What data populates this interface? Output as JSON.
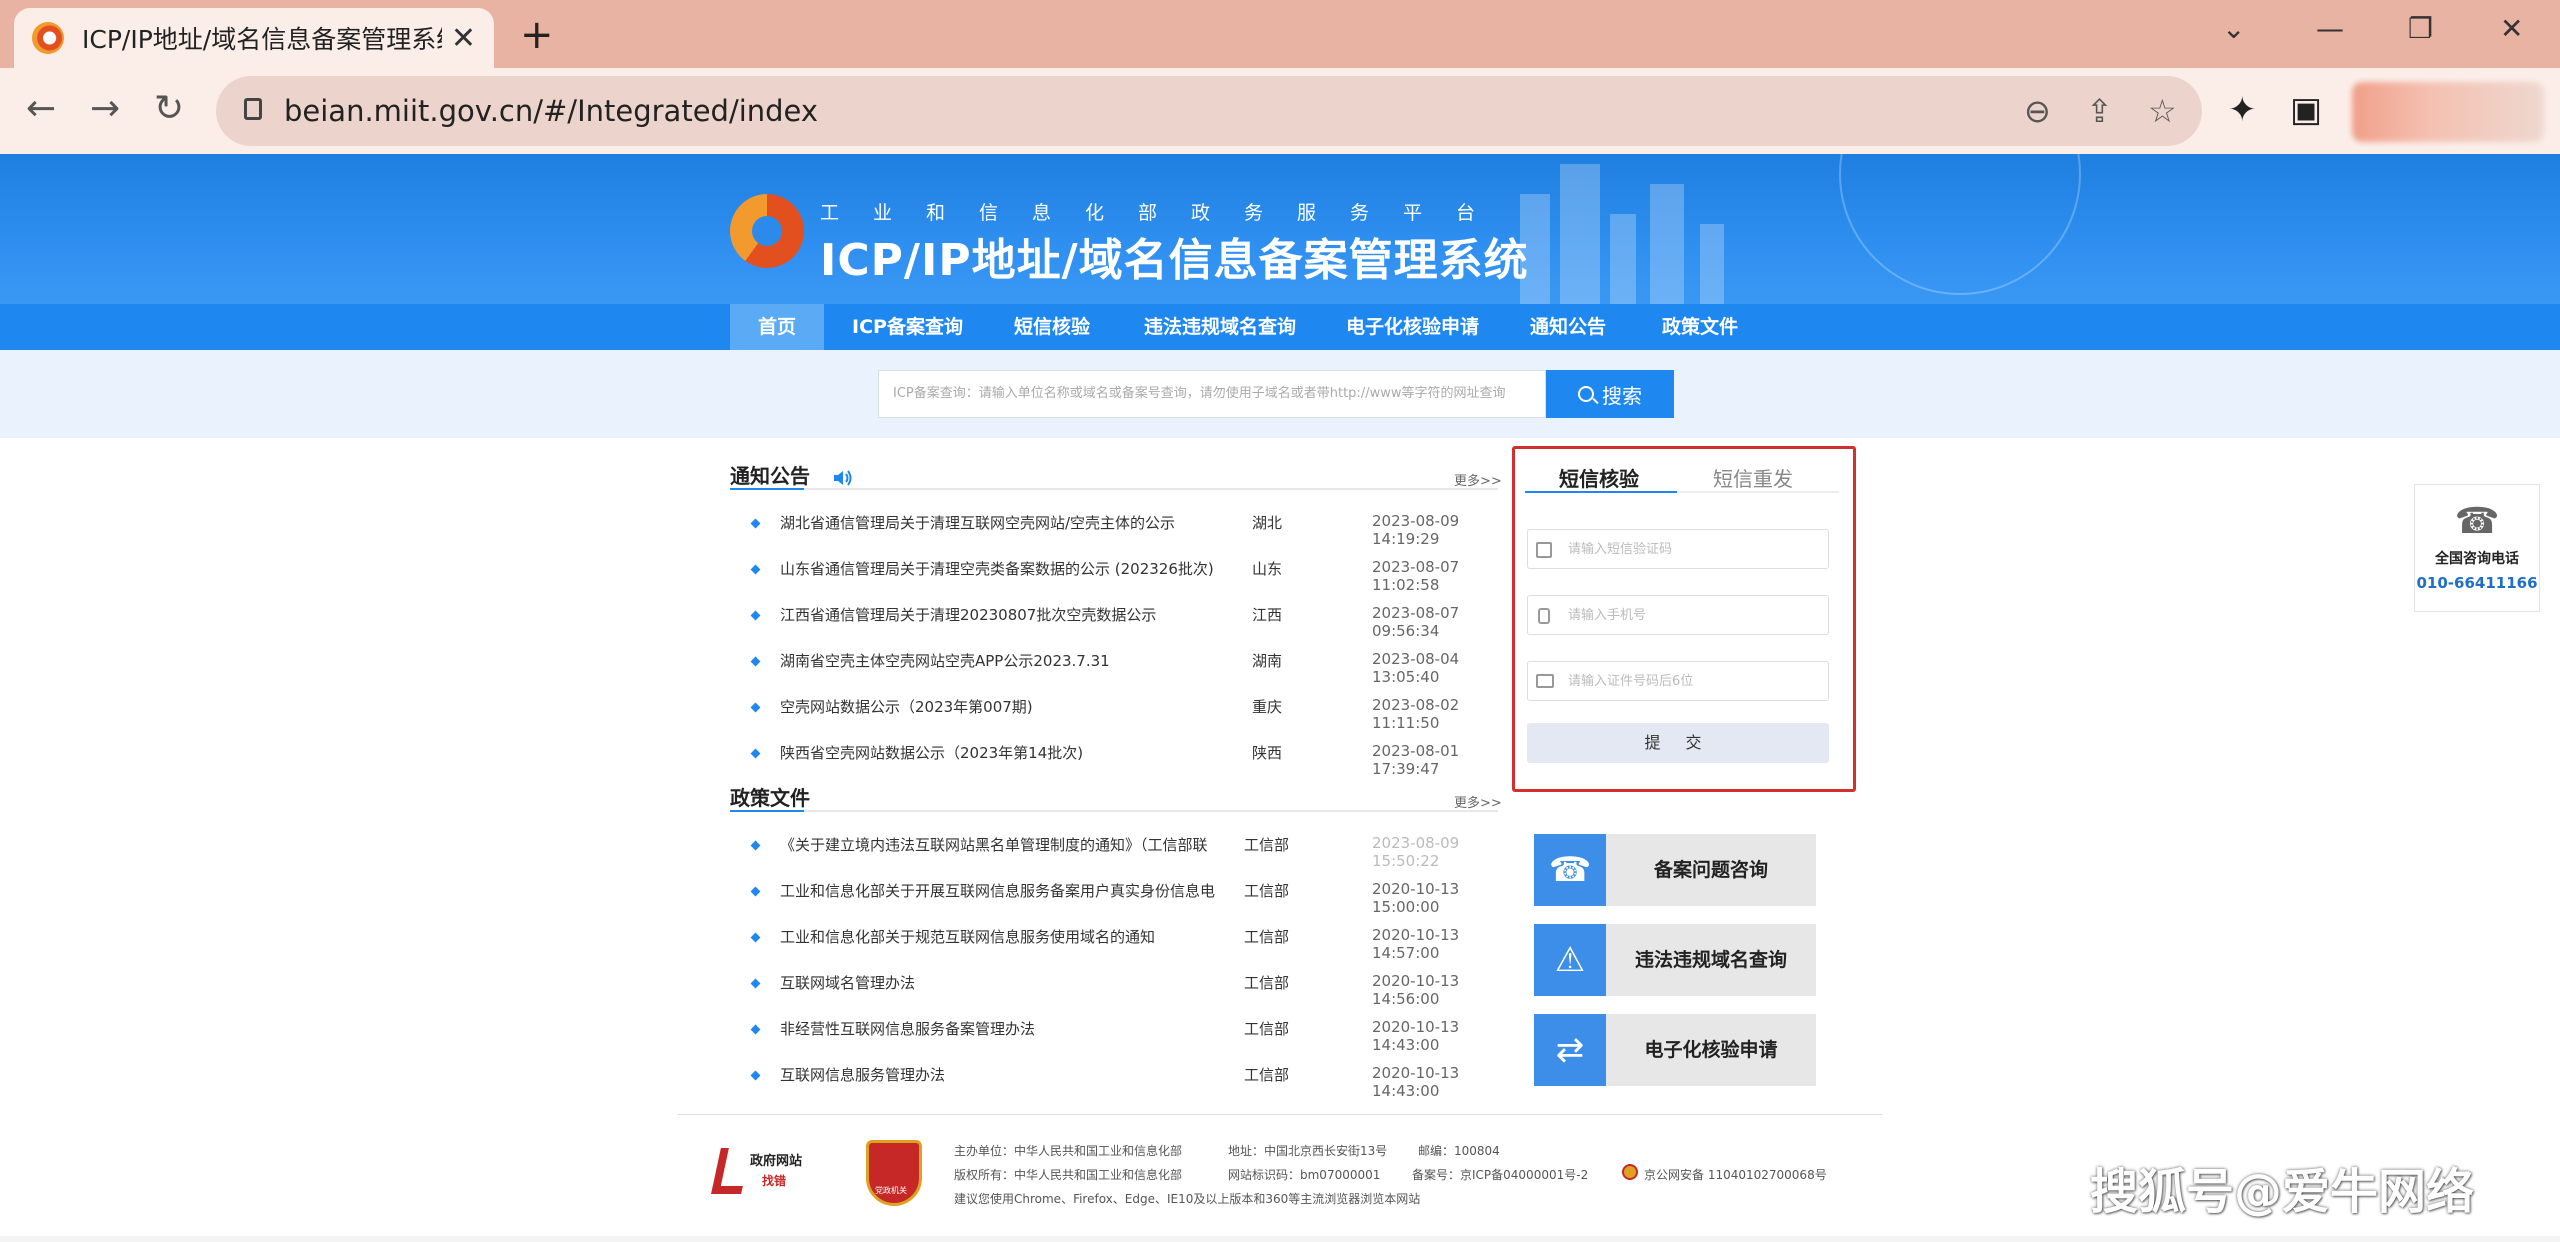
{
  "browser": {
    "tab_title": "ICP/IP地址/域名信息备案管理系统",
    "url": "beian.miit.gov.cn/#/Integrated/index"
  },
  "site": {
    "subtitle": "工业和信息化部政务服务平台",
    "title": "ICP/IP地址/域名信息备案管理系统"
  },
  "nav": {
    "items": [
      "首页",
      "ICP备案查询",
      "短信核验",
      "违法违规域名查询",
      "电子化核验申请",
      "通知公告",
      "政策文件"
    ]
  },
  "search": {
    "placeholder": "ICP备案查询：请输入单位名称或域名或备案号查询，请勿使用子域名或者带http://www等字符的网址查询",
    "button": "搜索"
  },
  "notices": {
    "title": "通知公告",
    "more": "更多>>",
    "rows": [
      {
        "title": "湖北省通信管理局关于清理互联网空壳网站/空壳主体的公示",
        "region": "湖北",
        "date": "2023-08-09 14:19:29"
      },
      {
        "title": "山东省通信管理局关于清理空壳类备案数据的公示 (202326批次)",
        "region": "山东",
        "date": "2023-08-07 11:02:58"
      },
      {
        "title": "江西省通信管理局关于清理20230807批次空壳数据公示",
        "region": "江西",
        "date": "2023-08-07 09:56:34"
      },
      {
        "title": "湖南省空壳主体空壳网站空壳APP公示2023.7.31",
        "region": "湖南",
        "date": "2023-08-04 13:05:40"
      },
      {
        "title": "空壳网站数据公示（2023年第007期)",
        "region": "重庆",
        "date": "2023-08-02 11:11:50"
      },
      {
        "title": "陕西省空壳网站数据公示（2023年第14批次)",
        "region": "陕西",
        "date": "2023-08-01 17:39:47"
      }
    ]
  },
  "policies": {
    "title": "政策文件",
    "more": "更多>>",
    "rows": [
      {
        "title": "《关于建立境内违法互联网站黑名单管理制度的通知》（工信部联",
        "region": "工信部",
        "date": "2023-08-09 15:50:22"
      },
      {
        "title": "工业和信息化部关于开展互联网信息服务备案用户真实身份信息电",
        "region": "工信部",
        "date": "2020-10-13 15:00:00"
      },
      {
        "title": "工业和信息化部关于规范互联网信息服务使用域名的通知",
        "region": "工信部",
        "date": "2020-10-13 14:57:00"
      },
      {
        "title": "互联网域名管理办法",
        "region": "工信部",
        "date": "2020-10-13 14:56:00"
      },
      {
        "title": "非经营性互联网信息服务备案管理办法",
        "region": "工信部",
        "date": "2020-10-13 14:43:00"
      },
      {
        "title": "互联网信息服务管理办法",
        "region": "工信部",
        "date": "2020-10-13 14:43:00"
      }
    ]
  },
  "sms": {
    "tab_verify": "短信核验",
    "tab_resend": "短信重发",
    "code_placeholder": "请输入短信验证码",
    "phone_placeholder": "请输入手机号",
    "id_placeholder": "请输入证件号码后6位",
    "submit": "提 交"
  },
  "quick_links": [
    "备案问题咨询",
    "违法违规域名查询",
    "电子化核验申请"
  ],
  "hotline": {
    "label": "全国咨询电话",
    "number": "010-66411166"
  },
  "footer": {
    "gov_site": "政府网站",
    "gov_find": "找错",
    "emblem_text": "党政机关",
    "line1_host": "主办单位：中华人民共和国工业和信息化部",
    "line1_addr": "地址：中国北京西长安街13号",
    "line1_zip": "邮编：100804",
    "line2_copy": "版权所有：中华人民共和国工业和信息化部",
    "line2_code": "网站标识码：bm07000001",
    "line2_icp": "备案号：京ICP备04000001号-2",
    "line2_police": "京公网安备 11040102700068号",
    "line3": "建议您使用Chrome、Firefox、Edge、IE10及以上版本和360等主流浏览器浏览本网站"
  },
  "watermark": "搜狐号@爱牛网络"
}
